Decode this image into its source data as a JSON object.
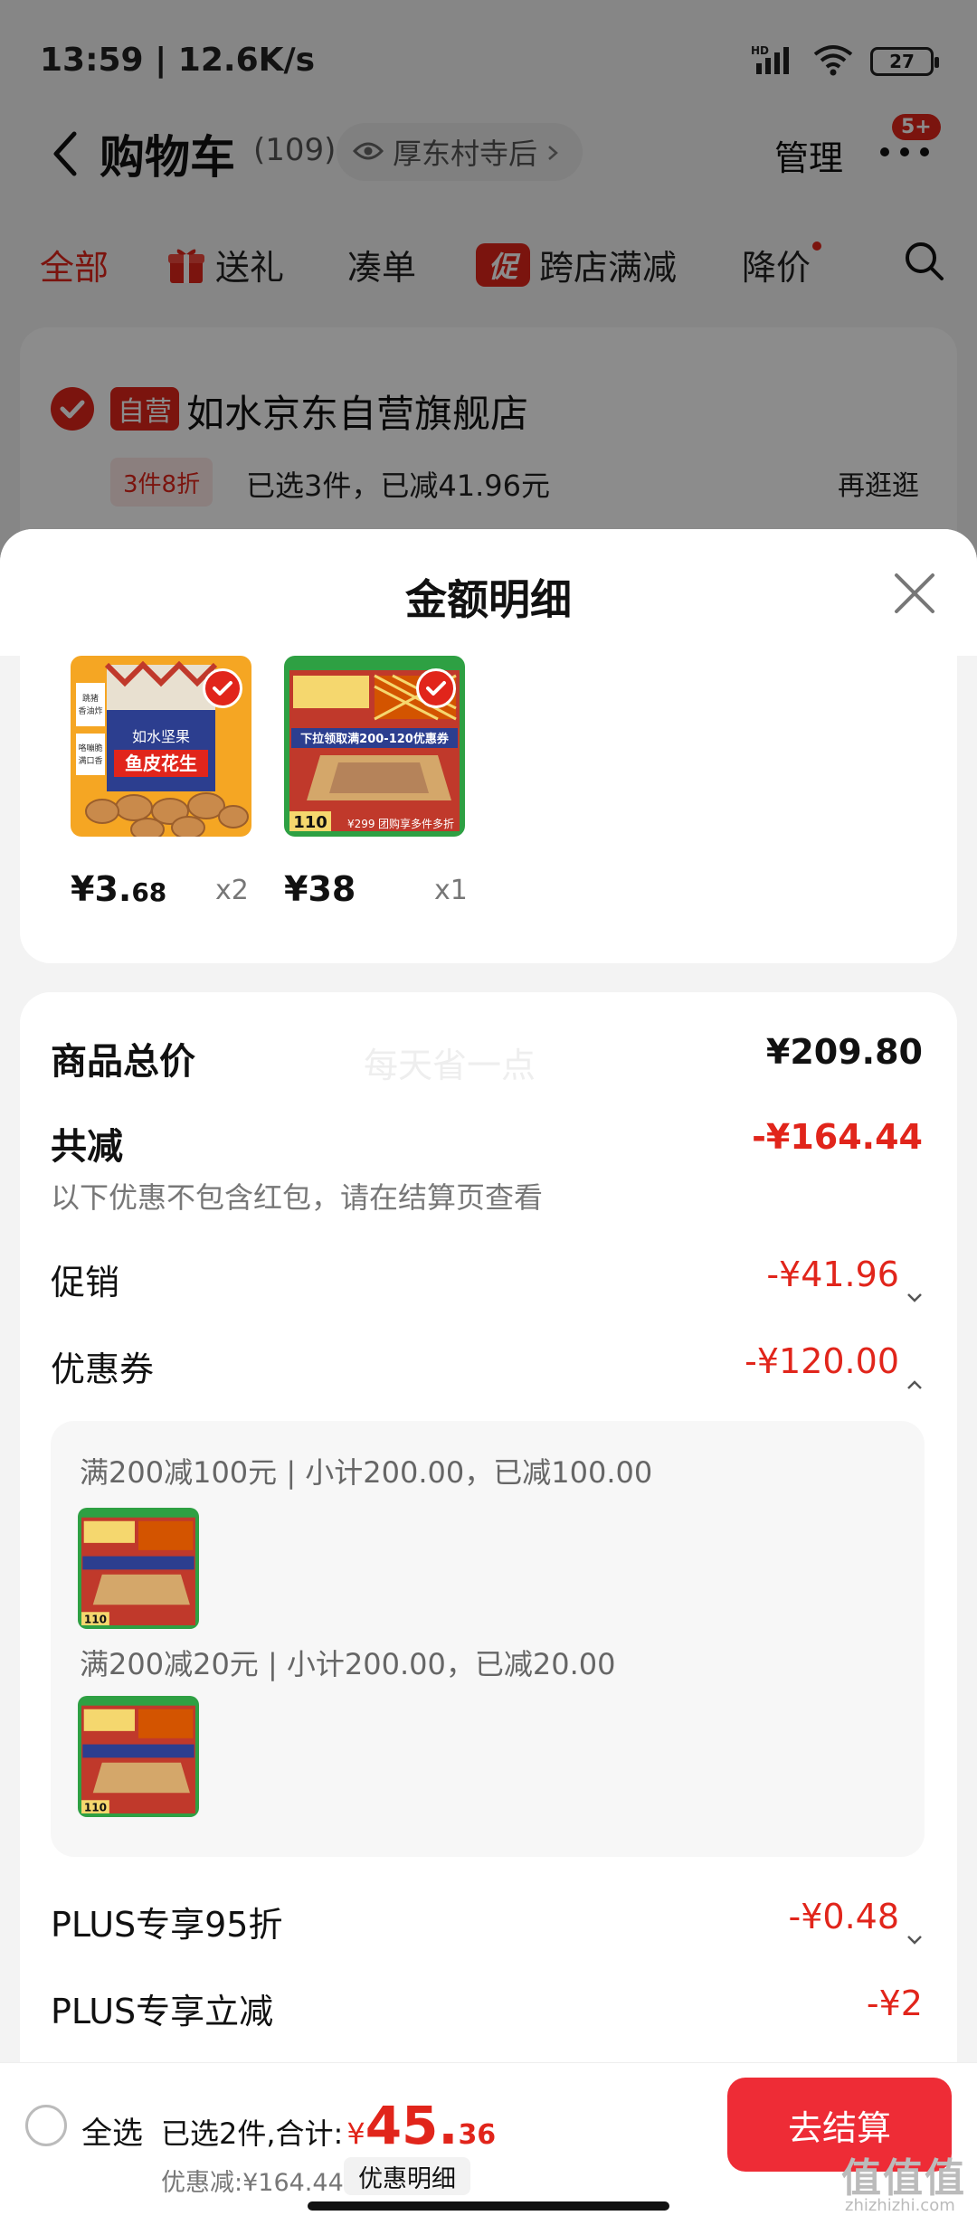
{
  "status_bar": {
    "time": "13:59 | 12.6K/s",
    "network": "HD",
    "battery": "27"
  },
  "header": {
    "title": "购物车",
    "count": "(109)",
    "location": "厚东村寺后",
    "manage": "管理",
    "badge": "5+"
  },
  "tabs": [
    {
      "label": "全部"
    },
    {
      "label": "送礼"
    },
    {
      "label": "凑单"
    },
    {
      "label": "跨店满减",
      "badge": "促"
    },
    {
      "label": "降价"
    }
  ],
  "store": {
    "tag": "自营",
    "name": "如水京东自营旗舰店",
    "promo_tag": "3件8折",
    "promo_text": "已选3件，已减41.96元",
    "shop_more": "再逛逛"
  },
  "sheet": {
    "title": "金额明细",
    "products": [
      {
        "price_int": "¥3.",
        "price_dec": "68",
        "qty": "x2",
        "thumb_text_1": "如水坚果",
        "thumb_text_2": "鱼皮花生",
        "thumb_text_3": "跳猪\n香油炸",
        "thumb_text_4": "咯嘣脆\n满口香"
      },
      {
        "price_int": "¥38",
        "price_dec": "",
        "qty": "x1",
        "thumb_text_1": "下拉领取满200-120优惠券",
        "thumb_text_2": "110",
        "thumb_text_3": "团购享多件多折",
        "thumb_text_4": "¥299"
      }
    ],
    "watermark": "每天省一点",
    "total_label": "商品总价",
    "total_value": "¥209.80",
    "reduce_label": "共减",
    "reduce_value": "-¥164.44",
    "reduce_note": "以下优惠不包含红包，请在结算页查看",
    "promo_label": "促销",
    "promo_value": "-¥41.96",
    "coupon_label": "优惠券",
    "coupon_value": "-¥120.00",
    "coupons": [
      {
        "text": "满200减100元 | 小计200.00，已减100.00"
      },
      {
        "text": "满200减20元 | 小计200.00，已减20.00"
      }
    ],
    "plus95_label": "PLUS专享95折",
    "plus95_value": "-¥0.48",
    "plus_reduce_label": "PLUS专享立减",
    "plus_reduce_value": "-¥2"
  },
  "bottom_bar": {
    "select_all": "全选",
    "selected_text": "已选2件,合计:",
    "yen": "¥",
    "total_int": "45.",
    "total_dec": "36",
    "discount": "优惠减:¥164.44",
    "detail_button": "优惠明细",
    "checkout": "去结算"
  },
  "site_mark": {
    "main": "值值值",
    "sub": "zhizhizhi.com"
  },
  "colors": {
    "accent": "#e1251b",
    "checkout": "#ee2c36",
    "product_green": "#2ea043"
  }
}
